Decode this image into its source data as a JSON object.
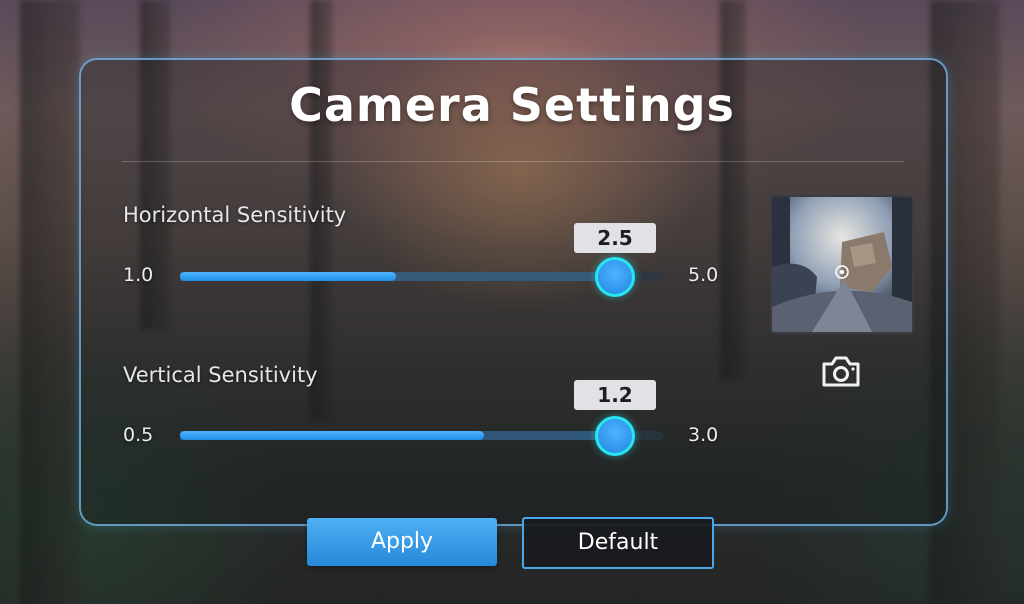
{
  "title": "Camera Settings",
  "horizontal": {
    "label": "Horizontal Sensitivity",
    "min_label": "1.0",
    "max_label": "5.0",
    "value_label": "2.5",
    "min": 1.0,
    "max": 5.0,
    "value": 2.5
  },
  "vertical": {
    "label": "Vertical Sensitivity",
    "min_label": "0.5",
    "max_label": "3.0",
    "value_label": "1.2",
    "min": 0.5,
    "max": 3.0,
    "value": 1.2
  },
  "preview": {
    "icon": "camera-icon"
  },
  "buttons": {
    "apply": "Apply",
    "default": "Default"
  },
  "colors": {
    "accent": "#2f9bf0",
    "thumb_ring": "#27e6f0",
    "panel_border": "#78bef0"
  }
}
